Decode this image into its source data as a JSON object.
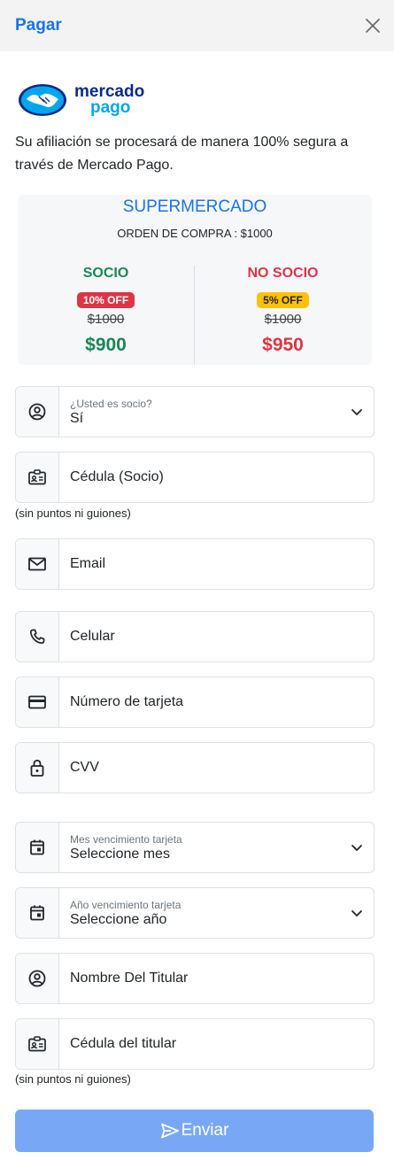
{
  "header": {
    "title": "Pagar"
  },
  "logo": {
    "line1": "mercado",
    "line2": "pago",
    "brand_colors": {
      "navy": "#0a2a88",
      "sky": "#00a6ee"
    }
  },
  "intro": {
    "text": "Su afiliación se procesará de manera 100% segura a través de Mercado Pago."
  },
  "summary": {
    "title": "SUPERMERCADO",
    "order": "ORDEN DE COMPRA : $1000",
    "member": {
      "title": "SOCIO",
      "badge": "10% OFF",
      "old_price": "$1000",
      "new_price": "$900",
      "color": "#198754"
    },
    "non_member": {
      "title": "NO SOCIO",
      "badge": "5% OFF",
      "old_price": "$1000",
      "new_price": "$950",
      "color": "#dc3545"
    }
  },
  "form": {
    "socio": {
      "label": "¿Usted es socio?",
      "value": "Sí",
      "icon": "user-circle-icon"
    },
    "cedula_socio": {
      "placeholder": "Cédula (Socio)",
      "hint": "(sin puntos ni guiones)",
      "icon": "id-card-icon"
    },
    "email": {
      "placeholder": "Email",
      "icon": "mail-icon"
    },
    "celular": {
      "placeholder": "Celular",
      "icon": "phone-icon"
    },
    "tarjeta": {
      "placeholder": "Número de tarjeta",
      "icon": "credit-card-icon"
    },
    "cvv": {
      "placeholder": "CVV",
      "icon": "lock-icon"
    },
    "mes": {
      "label": "Mes vencimiento tarjeta",
      "value": "Seleccione mes",
      "icon": "calendar-icon"
    },
    "anio": {
      "label": "Año vencimiento tarjeta",
      "value": "Seleccione año",
      "icon": "calendar-icon"
    },
    "titular": {
      "placeholder": "Nombre Del Titular",
      "icon": "user-circle-icon"
    },
    "cedula_titular": {
      "placeholder": "Cédula del titular",
      "hint": "(sin puntos ni guiones)",
      "icon": "id-card-icon"
    }
  },
  "submit": {
    "label": "Enviar",
    "color": "#78a8f5"
  }
}
